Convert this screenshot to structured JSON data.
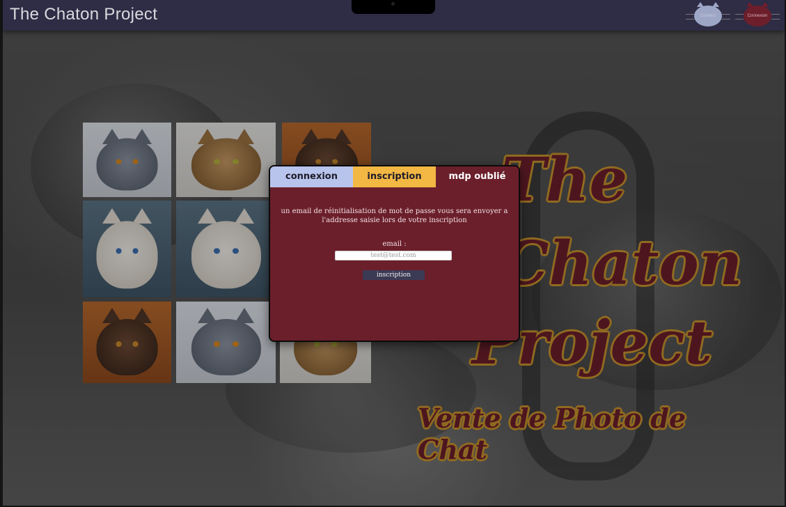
{
  "header": {
    "title": "The Chaton Project",
    "buttons": {
      "connect_label": "Connect",
      "connexion_label": "Connexion"
    }
  },
  "gallery": {
    "photos": [
      {
        "name": "grey-kitten-1",
        "style": "grey"
      },
      {
        "name": "bengal-kitten-1",
        "style": "bengal"
      },
      {
        "name": "brown-kitten-1",
        "style": "brown"
      },
      {
        "name": "white-kitten-1",
        "style": "white"
      },
      {
        "name": "white-kitten-2",
        "style": "white"
      },
      {
        "name": "brown-kitten-2",
        "style": "brown"
      },
      {
        "name": "grey-kitten-2",
        "style": "grey"
      },
      {
        "name": "bengal-kitten-2",
        "style": "bengal"
      }
    ]
  },
  "logo": {
    "line1": "The",
    "line2": "Chaton",
    "line3": "Project",
    "subtitle": "Vente de Photo de Chat"
  },
  "modal": {
    "tabs": {
      "connexion": "connexion",
      "inscription": "inscription",
      "mdp_oublie": "mdp oublié"
    },
    "message": "un email de réinitialisation de mot de passe vous sera envoyer a l'addresse saisie lors de votre inscription",
    "email_label": "email :",
    "email_placeholder": "test@test.com",
    "email_value": "",
    "submit_label": "inscription"
  },
  "colors": {
    "header_bg": "#2f2c45",
    "brand_maroon": "#6b1f2b",
    "brand_gold": "#c8942d",
    "tab_blue": "#b9c4ec",
    "tab_yellow": "#f3b744"
  }
}
